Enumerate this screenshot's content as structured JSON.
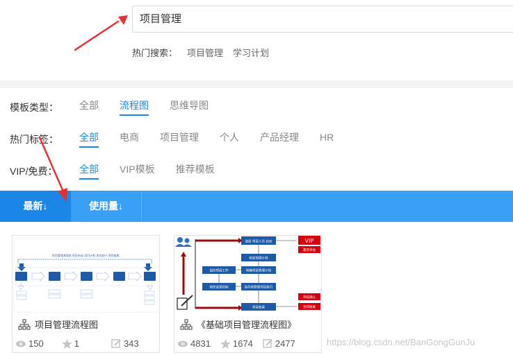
{
  "search": {
    "value": "项目管理"
  },
  "hot_search": {
    "label": "热门搜索：",
    "links": [
      "项目管理",
      "学习计划"
    ]
  },
  "filters": {
    "template_type": {
      "label": "模板类型：",
      "options": [
        "全部",
        "流程图",
        "思维导图"
      ],
      "active": "流程图"
    },
    "hot_tags": {
      "label": "热门标签：",
      "options": [
        "全部",
        "电商",
        "项目管理",
        "个人",
        "产品经理",
        "HR"
      ],
      "active": "全部"
    },
    "vip": {
      "label": "VIP/免费：",
      "options": [
        "全部",
        "VIP模板",
        "推荐模板"
      ],
      "active": "全部"
    }
  },
  "sort": {
    "tabs": [
      "最新↓",
      "使用量↓"
    ],
    "active": "最新↓"
  },
  "cards": [
    {
      "title": "项目管理流程图",
      "views": "150",
      "stars": "1",
      "edits": "343",
      "thumb_text": {
        "banner": "项目管理流程图 项目启动 项目计划 项目执行 项目收尾"
      }
    },
    {
      "title": "《基础项目管理流程图》",
      "views": "4831",
      "stars": "1674",
      "edits": "2477",
      "thumb_text": {
        "vip": "VIP",
        "b1": "选择 项目人员 启动",
        "b2": "制定范围计划",
        "b3": "明确项目管理计划",
        "b4": "监控项目工作",
        "b5": "明确项目计划",
        "b6": "修改变更控制",
        "b7": "指导和管理项目执行",
        "b8": "项目收尾",
        "r1": "需求评估",
        "r2": "审核确认",
        "r3": "合同收尾"
      }
    }
  ],
  "watermark": "https://blog.csdn.net/BanGongGunJu",
  "colors": {
    "accent": "#1a88e6",
    "sort_bar": "#3aa0f7",
    "annotation_arrow": "#e8312f",
    "vip_red": "#d7000f",
    "flow_blue": "#1f5aa6",
    "flow_darkred": "#9b0b0b"
  }
}
